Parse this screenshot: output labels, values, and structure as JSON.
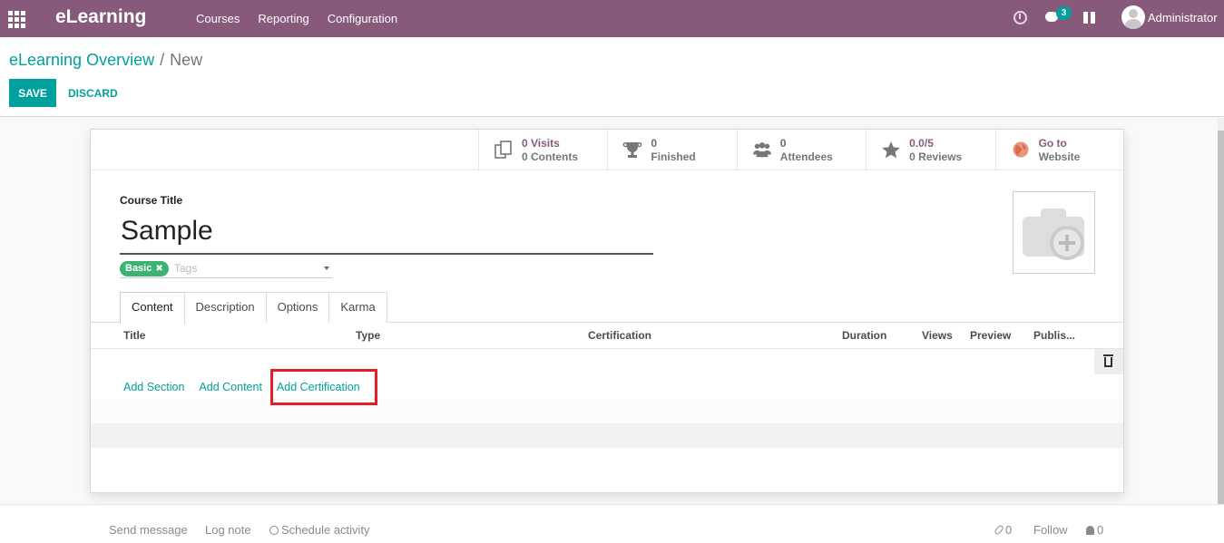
{
  "navbar": {
    "app_name": "eLearning",
    "menu": [
      "Courses",
      "Reporting",
      "Configuration"
    ],
    "chat_count": "3",
    "user_name": "Administrator"
  },
  "breadcrumb": {
    "parent": "eLearning Overview",
    "separator": "/",
    "current": "New"
  },
  "actions": {
    "save": "SAVE",
    "discard": "DISCARD"
  },
  "stats": [
    {
      "icon": "documents-icon",
      "value": "0 Visits",
      "label": "0 Contents"
    },
    {
      "icon": "trophy-icon",
      "value": "0",
      "label": "Finished"
    },
    {
      "icon": "users-icon",
      "value": "0",
      "label": "Attendees"
    },
    {
      "icon": "star-icon",
      "value": "0.0/5",
      "label": "0 Reviews"
    },
    {
      "icon": "globe-icon",
      "value": "Go to",
      "label": "Website"
    }
  ],
  "form": {
    "title_label": "Course Title",
    "title_value": "Sample",
    "tag": "Basic",
    "tags_placeholder": "Tags"
  },
  "tabs": [
    "Content",
    "Description",
    "Options",
    "Karma"
  ],
  "table": {
    "columns": [
      "Title",
      "Type",
      "Certification",
      "Duration",
      "Views",
      "Preview",
      "Publis..."
    ]
  },
  "add_links": [
    "Add Section",
    "Add Content",
    "Add Certification"
  ],
  "chatter": {
    "send_message": "Send message",
    "log_note": "Log note",
    "schedule_activity": "Schedule activity",
    "attachments": "0",
    "follow": "Follow",
    "followers": "0"
  },
  "colors": {
    "navbar": "#875a7b",
    "accent": "#00a09d",
    "highlight": "#e41e26",
    "tag": "#3cb371"
  }
}
